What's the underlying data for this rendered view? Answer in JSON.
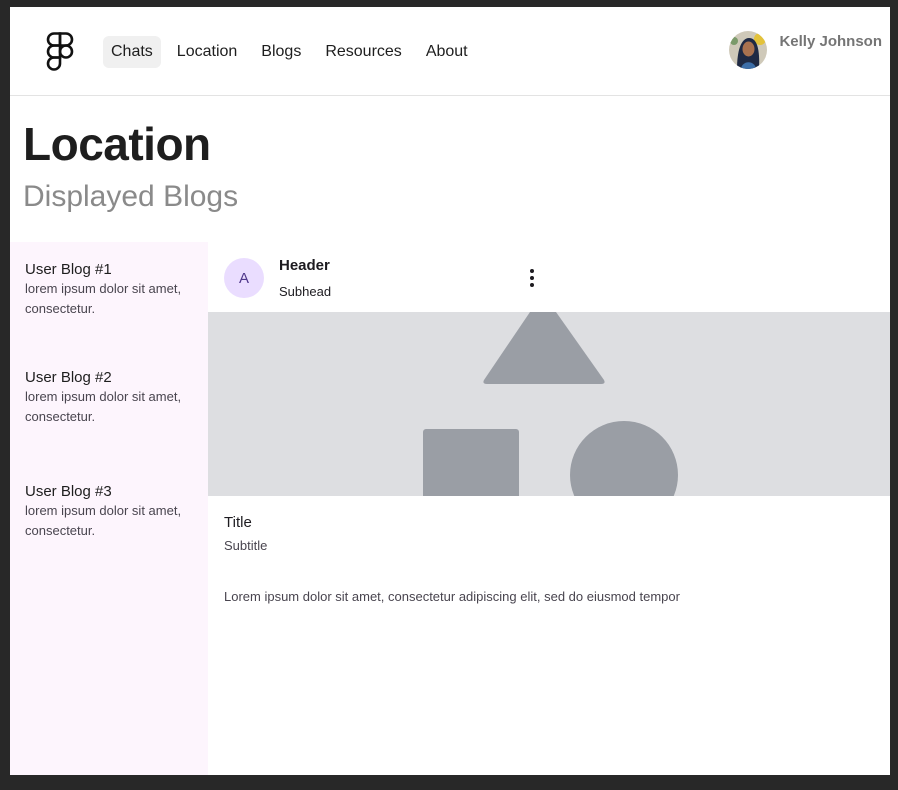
{
  "nav": {
    "logo_icon": "figma-logo-icon",
    "items": [
      {
        "label": "Chats",
        "active": true
      },
      {
        "label": "Location",
        "active": false
      },
      {
        "label": "Blogs",
        "active": false
      },
      {
        "label": "Resources",
        "active": false
      },
      {
        "label": "About",
        "active": false
      }
    ]
  },
  "user": {
    "name": "Kelly Johnson",
    "avatar_icon": "user-avatar"
  },
  "page": {
    "title": "Location",
    "subtitle": "Displayed Blogs"
  },
  "sidebar": {
    "items": [
      {
        "title": "User Blog #1",
        "description": "lorem ipsum dolor sit amet, consectetur."
      },
      {
        "title": "User Blog #2",
        "description": "lorem ipsum dolor sit amet, consectetur."
      },
      {
        "title": "User Blog #3",
        "description": "lorem ipsum dolor sit amet, consectetur."
      }
    ]
  },
  "card": {
    "monogram": "A",
    "header": "Header",
    "subhead": "Subhead",
    "menu_icon": "more-vertical-icon",
    "media_icon": "shapes-placeholder-icon",
    "title": "Title",
    "subtitle": "Subtitle",
    "body": "Lorem ipsum dolor sit amet, consectetur adipiscing elit, sed do eiusmod tempor"
  },
  "colors": {
    "page_background": "#282828",
    "sidebar_background": "#fdf5fd",
    "active_nav_background": "#f0f0f0",
    "monogram_background": "#eaddff",
    "media_background": "#dddee1",
    "media_shapes": "#9a9ea5"
  }
}
